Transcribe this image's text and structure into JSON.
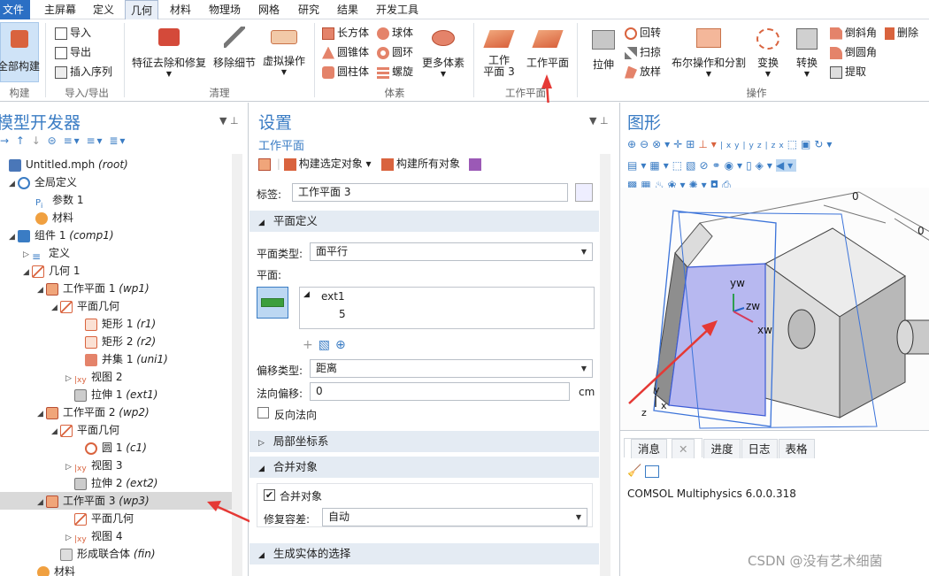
{
  "menu": {
    "file": "文件",
    "items": [
      "主屏幕",
      "定义",
      "几何",
      "材料",
      "物理场",
      "网格",
      "研究",
      "结果",
      "开发工具"
    ]
  },
  "ribbon": {
    "build_all": "全部构建",
    "groups": {
      "build": "构建",
      "import_export": "导入/导出",
      "cleanup": "清理",
      "primitives": "体素",
      "work_plane": "工作平面",
      "operations": "操作"
    },
    "import": "导入",
    "export": "导出",
    "insert_sequence": "插入序列",
    "defeature": "特征去除和修复",
    "remove_details": "移除细节",
    "virtual_ops": "虚拟操作",
    "block": "长方体",
    "sphere": "球体",
    "cone": "圆锥体",
    "torus": "圆环",
    "cylinder": "圆柱体",
    "helix": "螺旋",
    "more_primitives": "更多体素",
    "work_plane_3": "工作",
    "work_plane_3b": "平面 3",
    "work_plane_btn": "工作平面",
    "extrude": "拉伸",
    "revolve": "回转",
    "sweep": "扫掠",
    "loft": "放样",
    "booleans": "布尔操作和分割",
    "transforms": "变换",
    "conversions": "转换",
    "chamfer": "倒斜角",
    "fillet": "倒圆角",
    "extract": "提取",
    "delete": "删除"
  },
  "model_builder": {
    "title": "模型开发器",
    "tree": [
      {
        "label": "Untitled.mph",
        "tag": "(root)"
      },
      {
        "label": "全局定义",
        "tag": ""
      },
      {
        "label": "参数 1",
        "tag": ""
      },
      {
        "label": "材料",
        "tag": ""
      },
      {
        "label": "组件 1",
        "tag": "(comp1)"
      },
      {
        "label": "定义",
        "tag": ""
      },
      {
        "label": "几何 1",
        "tag": ""
      },
      {
        "label": "工作平面 1",
        "tag": "(wp1)"
      },
      {
        "label": "平面几何",
        "tag": ""
      },
      {
        "label": "矩形 1",
        "tag": "(r1)"
      },
      {
        "label": "矩形 2",
        "tag": "(r2)"
      },
      {
        "label": "并集 1",
        "tag": "(uni1)"
      },
      {
        "label": "视图 2",
        "tag": ""
      },
      {
        "label": "拉伸 1",
        "tag": "(ext1)"
      },
      {
        "label": "工作平面 2",
        "tag": "(wp2)"
      },
      {
        "label": "平面几何",
        "tag": ""
      },
      {
        "label": "圆 1",
        "tag": "(c1)"
      },
      {
        "label": "视图 3",
        "tag": ""
      },
      {
        "label": "拉伸 2",
        "tag": "(ext2)"
      },
      {
        "label": "工作平面 3",
        "tag": "(wp3)"
      },
      {
        "label": "平面几何",
        "tag": ""
      },
      {
        "label": "视图 4",
        "tag": ""
      },
      {
        "label": "形成联合体",
        "tag": "(fin)"
      },
      {
        "label": "材料",
        "tag": ""
      }
    ]
  },
  "settings": {
    "title": "设置",
    "subtitle": "工作平面",
    "build_selected": "构建选定对象",
    "build_all": "构建所有对象",
    "label_caption": "标签:",
    "label_value": "工作平面 3",
    "section_plane_def": "平面定义",
    "plane_type_caption": "平面类型:",
    "plane_type_value": "面平行",
    "plane_caption": "平面:",
    "plane_list": [
      "ext1",
      "5"
    ],
    "offset_type_caption": "偏移类型:",
    "offset_type_value": "距离",
    "normal_offset_caption": "法向偏移:",
    "normal_offset_value": "0",
    "normal_offset_unit": "cm",
    "reverse_normal": "反向法向",
    "section_local_coords": "局部坐标系",
    "section_unite": "合并对象",
    "unite_objects": "合并对象",
    "repair_tol_caption": "修复容差:",
    "repair_tol_value": "自动",
    "section_resulting": "生成实体的选择"
  },
  "graphics": {
    "title": "图形",
    "axis_label_top": "0",
    "axis_label_right": "0",
    "axes": {
      "yw": "yw",
      "zw": "zw",
      "xw": "xw",
      "y": "y",
      "x": "x",
      "z": "z"
    }
  },
  "messages": {
    "tabs": [
      "消息",
      "进度",
      "日志",
      "表格"
    ],
    "text": "COMSOL Multiphysics 6.0.0.318"
  },
  "watermark": "CSDN @没有艺术细菌",
  "colors": {
    "accent": "#2b6fc4",
    "plane": "#b7b8f0",
    "arrow": "#e53935"
  }
}
